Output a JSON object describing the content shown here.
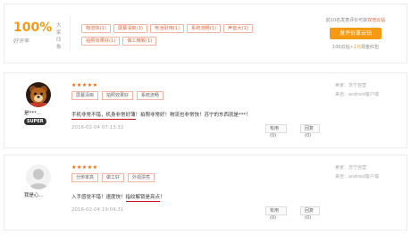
{
  "summary": {
    "rate": "100%",
    "rate_label": "好评率",
    "impression_label": "大家印象",
    "tags": [
      "物流快(1)",
      "屏幕清晰(1)",
      "电池耐用(1)",
      "系统流畅(1)",
      "声音大(1)",
      "拍照效果好(1)",
      "做工精致(1)"
    ],
    "promo_text_prefix": "前10名发表评价可获",
    "promo_text_highlight": "双倍云钻",
    "promo_button": "发评价拿云钻",
    "promo_sub_prefix": "100云钻",
    "promo_sub_highlight": "+1元",
    "promo_sub_suffix": "现金红包"
  },
  "reviews": [
    {
      "username": "是***...",
      "badge": "SUPER",
      "stars": "★★★★★",
      "tags": [
        "屏幕清晰",
        "拍照效果好",
        "系统流畅"
      ],
      "content_underlined": "手机非常不错，机身非常好薄",
      "content_rest": "！拍照非常好！物流也非常快！苏宁的东西就是***！",
      "date": "2016-02-04 07:13:32",
      "useful_label": "有用(0)",
      "reply_label": "回复(0)",
      "meta_store": "卖家：苏宁自营",
      "meta_source": "来自：android客户端"
    },
    {
      "username": "我是心...",
      "stars": "★★★★★",
      "tags": [
        "分辨率高",
        "做工好",
        "外观漂亮"
      ],
      "content_plain": "入手感觉不错！速度快！",
      "content_underlined": "指纹解锁是亮点",
      "content_rest": "！",
      "date": "2016-02-04 19:04:31",
      "useful_label": "有用(0)",
      "reply_label": "回复(0)",
      "meta_store": "卖家：苏宁自营",
      "meta_source": "来自：android客户端"
    }
  ],
  "colors": {
    "accent_orange": "#f59a12",
    "tag_border": "#f0b4a0",
    "underline_red": "#c8161d",
    "star_color": "#ff6600"
  }
}
